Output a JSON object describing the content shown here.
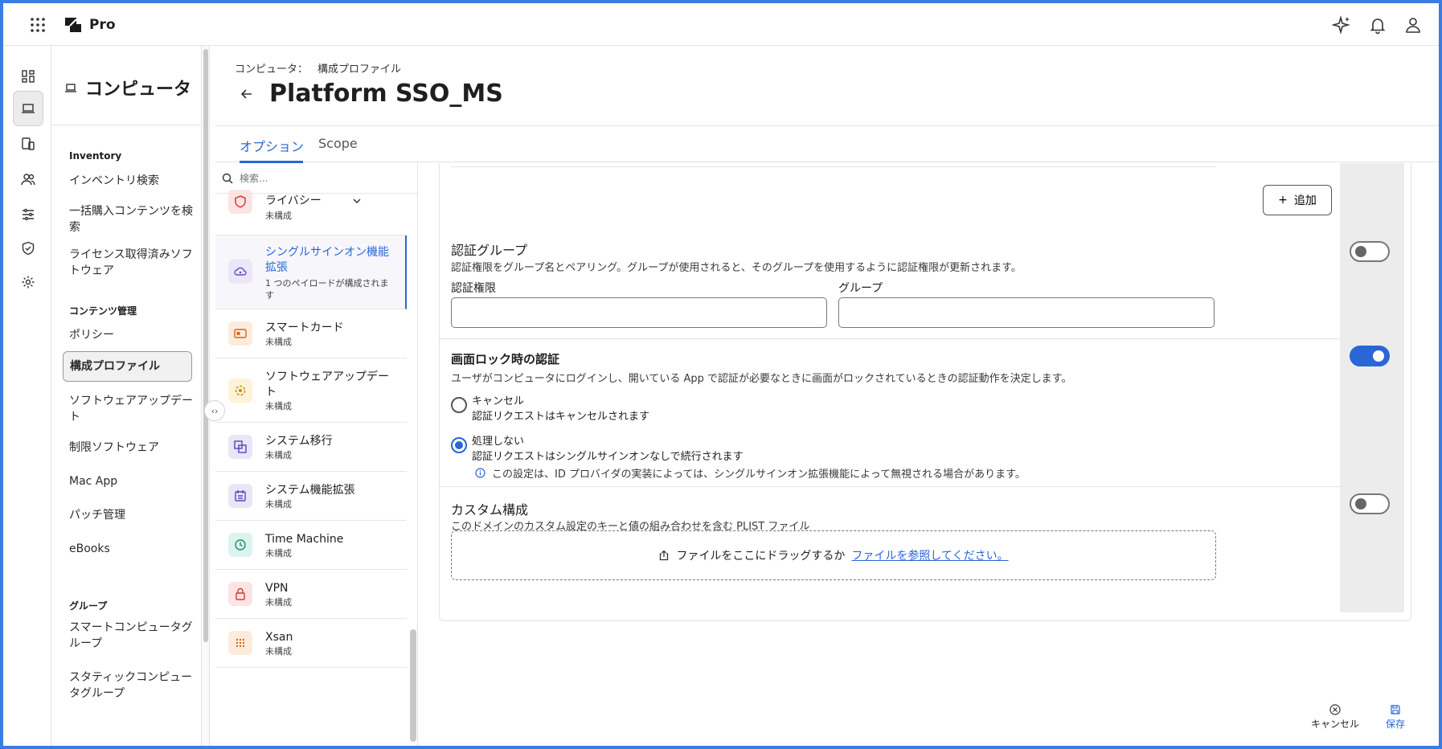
{
  "app": {
    "name": "Pro"
  },
  "colors": {
    "accent": "#2a66d6",
    "frame": "#3b7ce0"
  },
  "leftnav": {
    "title": "コンピュータ",
    "sections": {
      "inventory": "Inventory",
      "content": "コンテンツ管理",
      "groups": "グループ"
    },
    "items": {
      "inventory_search": "インベントリ検索",
      "bulk_content_search": "一括購入コンテンツを検索",
      "licensed_software": "ライセンス取得済みソフトウェア",
      "policies": "ポリシー",
      "config_profiles": "構成プロファイル",
      "software_updates": "ソフトウェアアップデート",
      "restricted_software": "制限ソフトウェア",
      "mac_app": "Mac App",
      "patch_management": "パッチ管理",
      "ebooks": "eBooks",
      "smart_groups": "スマートコンピュータグループ",
      "static_groups": "スタティックコンピュータグループ"
    }
  },
  "header": {
    "breadcrumb_root": "コンピュータ：",
    "breadcrumb_current": "構成プロファイル",
    "title": "Platform SSO_MS"
  },
  "tabs": {
    "options": "オプション",
    "scope": "Scope"
  },
  "payloads": {
    "search_placeholder": "検索...",
    "items": [
      {
        "name": "ライバシー",
        "status": "未構成"
      },
      {
        "name": "シングルサインオン機能拡張",
        "status": "1 つのペイロードが構成されます"
      },
      {
        "name": "スマートカード",
        "status": "未構成"
      },
      {
        "name": "ソフトウェアアップデート",
        "status": "未構成"
      },
      {
        "name": "システム移行",
        "status": "未構成"
      },
      {
        "name": "システム機能拡張",
        "status": "未構成"
      },
      {
        "name": "Time Machine",
        "status": "未構成"
      },
      {
        "name": "VPN",
        "status": "未構成"
      },
      {
        "name": "Xsan",
        "status": "未構成"
      }
    ]
  },
  "content": {
    "add_label": "追加",
    "auth_groups": {
      "title": "認証グループ",
      "desc": "認証権限をグループ名とペアリング。グループが使用されると、そのグループを使用するように認証権限が更新されます。",
      "field_right": "認証権限",
      "field_group": "グループ",
      "enabled": false
    },
    "screen_lock": {
      "title": "画面ロック時の認証",
      "desc": "ユーザがコンピュータにログインし、開いている App で認証が必要なときに画面がロックされているときの認証動作を決定します。",
      "enabled": true,
      "option_cancel_label": "キャンセル",
      "option_cancel_desc": "認証リクエストはキャンセルされます",
      "option_none_label": "処理しない",
      "option_none_desc": "認証リクエストはシングルサインオンなしで続行されます",
      "note": "この設定は、ID プロバイダの実装によっては、シングルサインオン拡張機能によって無視される場合があります。",
      "selected": "処理しない"
    },
    "custom": {
      "title": "カスタム構成",
      "desc": "このドメインのカスタム設定のキーと値の組み合わせを含む PLIST ファイル",
      "drop_text": "ファイルをここにドラッグするか",
      "browse_link": "ファイルを参照してください。",
      "enabled": false
    }
  },
  "footer": {
    "cancel": "キャンセル",
    "save": "保存"
  }
}
